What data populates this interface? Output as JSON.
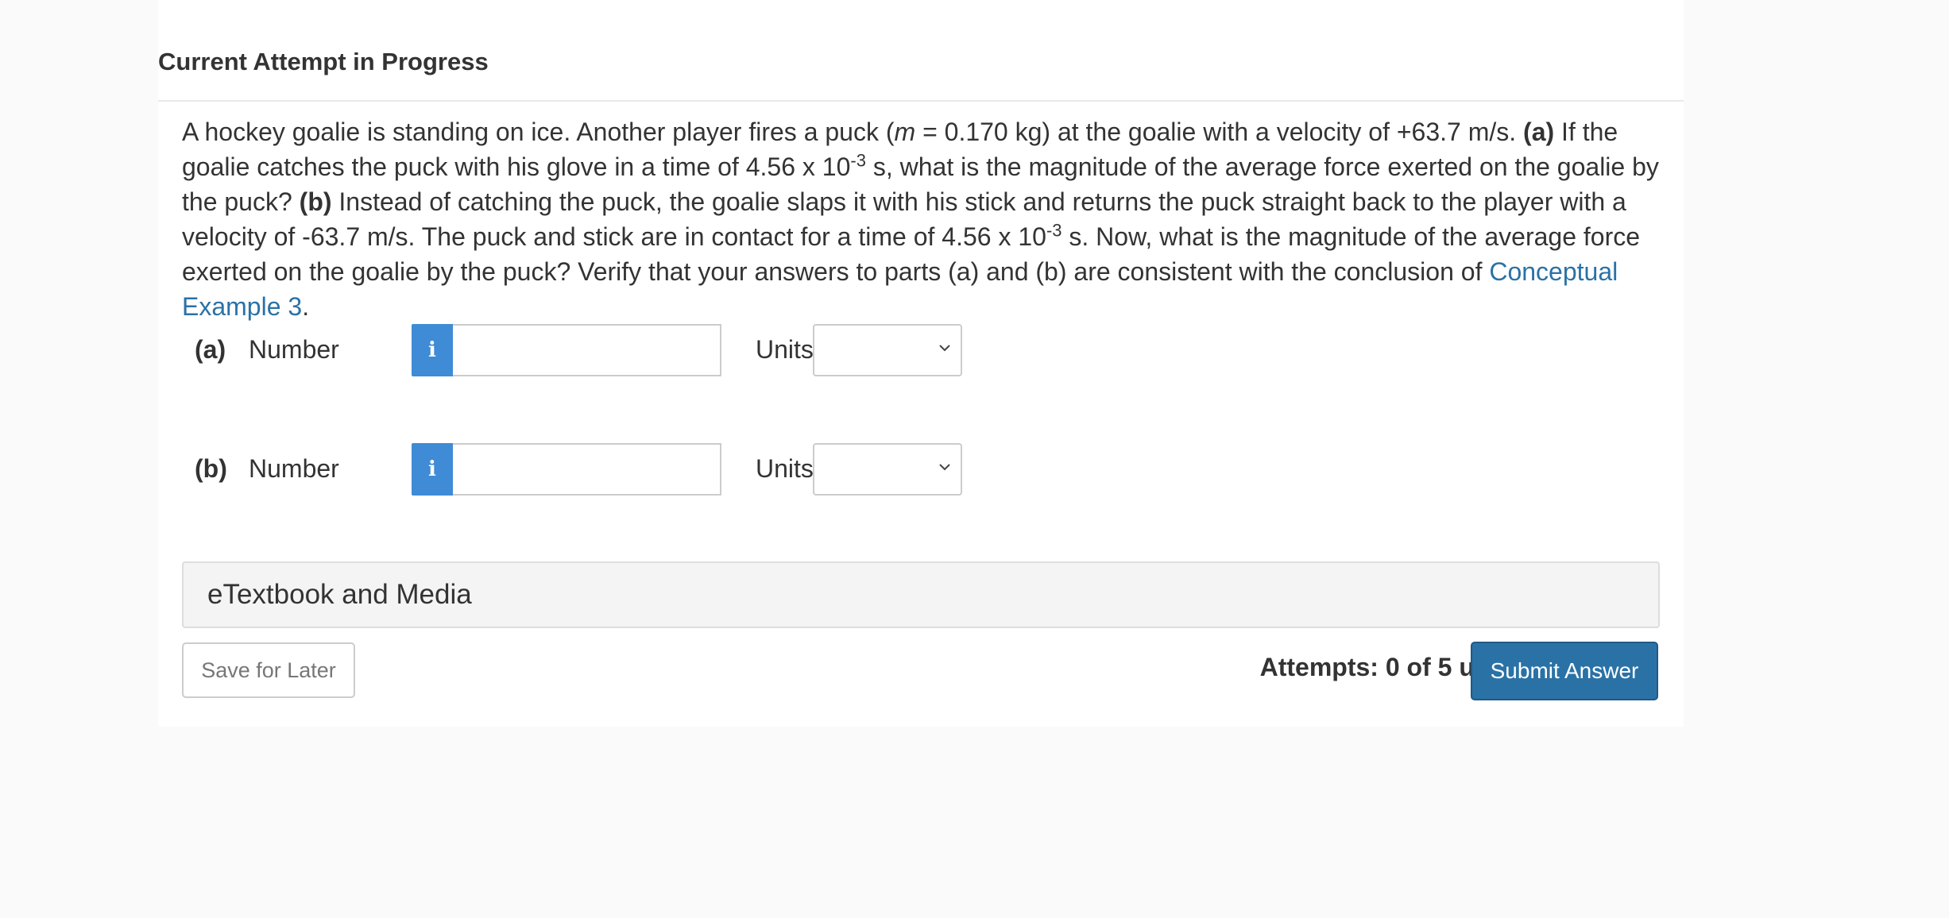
{
  "header": {
    "title": "Current Attempt in Progress"
  },
  "question": {
    "segments": {
      "s1": "A hockey goalie is standing on ice. Another player fires a puck (",
      "m": "m",
      "s2": " = 0.170 kg) at the goalie with a velocity of +63.7 m/s. ",
      "a": "(a)",
      "s3": " If the goalie catches the puck with his glove in a time of 4.56 x 10",
      "exp1": "-3",
      "s4": " s, what is the magnitude of the average force exerted on the goalie by the puck? ",
      "b": "(b)",
      "s5": " Instead of catching the puck, the goalie slaps it with his stick and returns the puck straight back to the player with a velocity of -63.7 m/s. The puck and stick are in contact for a time of 4.56 x 10",
      "exp2": "-3",
      "s6": " s. Now, what is the magnitude of the average force exerted on the goalie by the puck? Verify that your answers to parts (a) and (b) are consistent with the conclusion of ",
      "link": "Conceptual Example 3",
      "s7": "."
    }
  },
  "parts": [
    {
      "label": "(a)",
      "number_label": "Number",
      "info_glyph": "i",
      "value": "",
      "units_label": "Units",
      "units_value": ""
    },
    {
      "label": "(b)",
      "number_label": "Number",
      "info_glyph": "i",
      "value": "",
      "units_label": "Units",
      "units_value": ""
    }
  ],
  "etext": {
    "label": "eTextbook and Media"
  },
  "footer": {
    "save_label": "Save for Later",
    "attempts_label": "Attempts: 0 of 5 used",
    "submit_label": "Submit Answer"
  },
  "colors": {
    "accent": "#2a72a6",
    "info": "#3f8bd6",
    "text": "#333333"
  },
  "icons": {
    "info": "info-icon",
    "select": "chevron-down-icon"
  }
}
